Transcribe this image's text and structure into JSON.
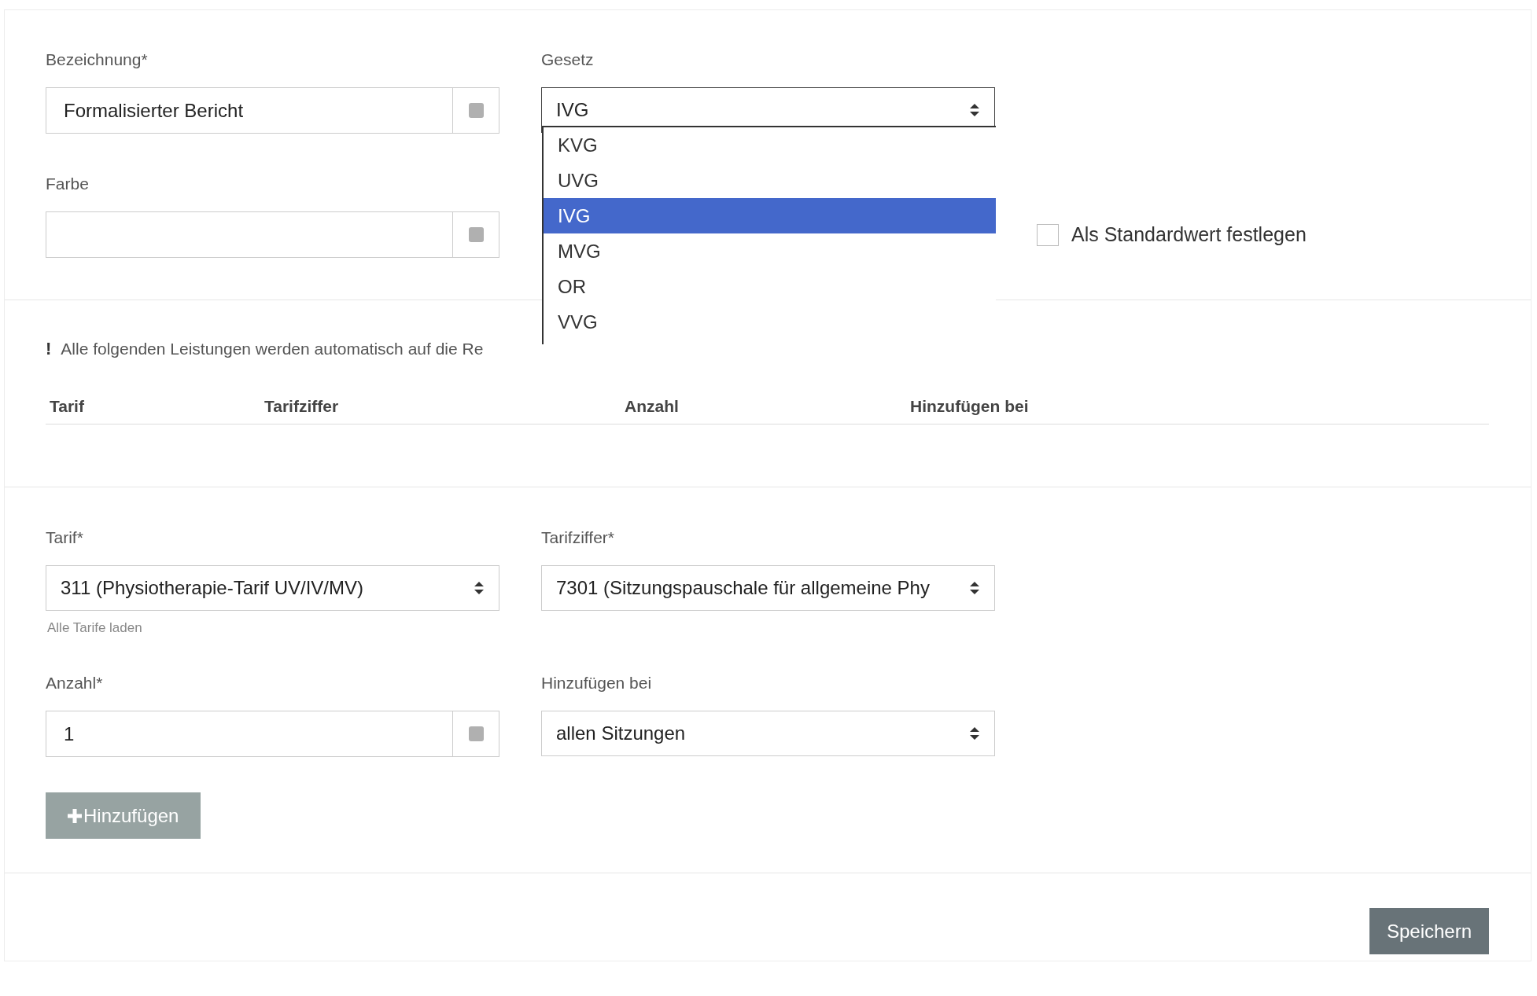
{
  "bezeichnung": {
    "label": "Bezeichnung*",
    "value": "Formalisierter Bericht"
  },
  "gesetz": {
    "label": "Gesetz",
    "value": "IVG",
    "expanded": true,
    "options": [
      {
        "label": "KVG",
        "selected": false
      },
      {
        "label": "UVG",
        "selected": false
      },
      {
        "label": "IVG",
        "selected": true
      },
      {
        "label": "MVG",
        "selected": false
      },
      {
        "label": "OR",
        "selected": false
      },
      {
        "label": "VVG",
        "selected": false
      }
    ]
  },
  "farbe": {
    "label": "Farbe"
  },
  "default_checkbox": {
    "label": "Als Standardwert festlegen",
    "checked": false
  },
  "notice": {
    "icon": "!",
    "text": "Alle folgenden Leistungen werden automatisch auf die Re"
  },
  "table": {
    "columns": [
      "Tarif",
      "Tarifziffer",
      "Anzahl",
      "Hinzufügen bei"
    ]
  },
  "tarif": {
    "label": "Tarif*",
    "value": "311 (Physiotherapie-Tarif UV/IV/MV)",
    "link": "Alle Tarife laden"
  },
  "tarifziffer": {
    "label": "Tarifziffer*",
    "value": "7301 (Sitzungspauschale für allgemeine Phy"
  },
  "anzahl": {
    "label": "Anzahl*",
    "value": "1"
  },
  "hinzufuegen_bei": {
    "label": "Hinzufügen bei",
    "value": "allen Sitzungen"
  },
  "add_button": {
    "label": "Hinzufügen"
  },
  "save_button": {
    "label": "Speichern"
  }
}
